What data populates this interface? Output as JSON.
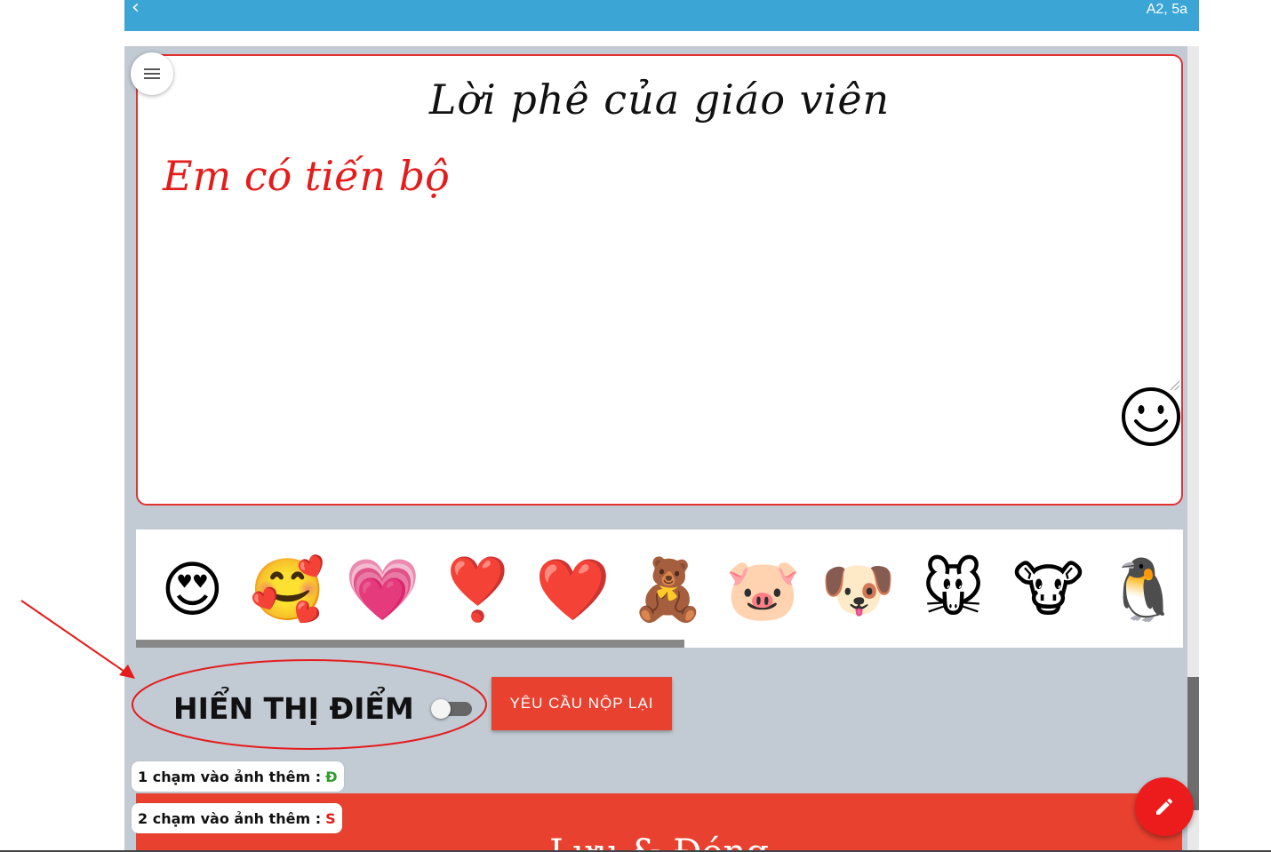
{
  "header": {
    "back_icon": "chevron-left-icon",
    "class_label": "A2, 5a",
    "color": "#3ba5d6"
  },
  "comment": {
    "title": "Lời phê của giáo viên",
    "text": "Em có tiến bộ",
    "text_color": "#e41c1c",
    "border_color": "#e53030"
  },
  "emojis": [
    "😍",
    "🥰",
    "💗",
    "❣️",
    "❤️",
    "🧸",
    "🐷",
    "🐶",
    "🐭",
    "🐮",
    "🐧"
  ],
  "emoji_names": [
    "heart-eyes",
    "smiling-face-with-hearts",
    "growing-heart",
    "heart-exclamation",
    "sparkling-red-heart",
    "teddy-bear",
    "pig-face",
    "dog-face",
    "mouse-face",
    "cow-face",
    "penguin"
  ],
  "score": {
    "label": "HIỂN THỊ ĐIỂM",
    "toggle_on": false
  },
  "resubmit": {
    "label": "YÊU CẦU NỘP LẠI",
    "color": "#e8412f"
  },
  "hints": {
    "one_tap": "1 chạm vào ảnh thêm :",
    "one_tap_mark": "Đ",
    "two_tap": "2 chạm vào ảnh thêm :",
    "two_tap_mark": "S"
  },
  "footer_panel": {
    "partial_text": "Lưu & Đóng"
  },
  "fab_icon": "pencil-icon"
}
